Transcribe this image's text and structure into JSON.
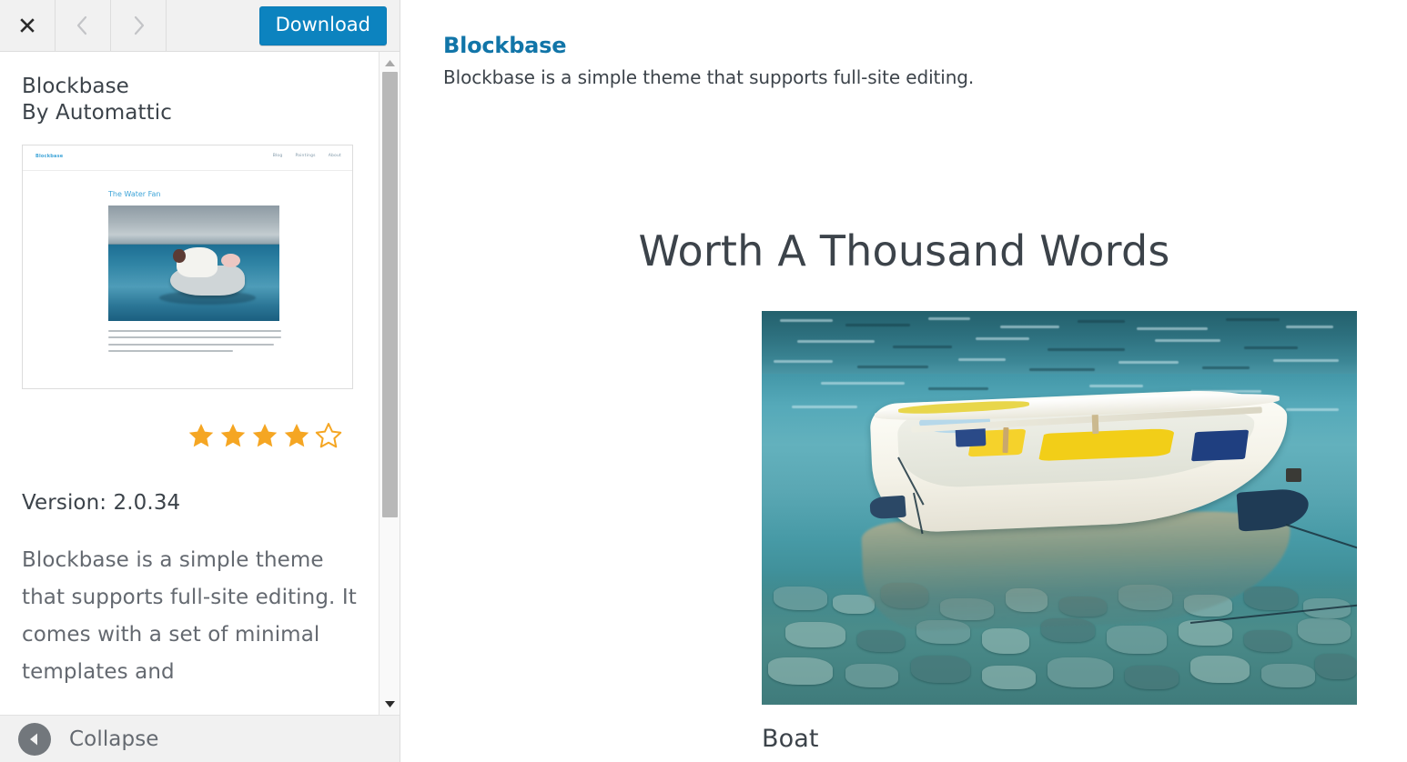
{
  "toolbar": {
    "close_icon": "close-x-icon",
    "prev_icon": "chevron-left-icon",
    "next_icon": "chevron-right-icon",
    "download_label": "Download",
    "accent_color": "#0c83bf"
  },
  "sidebar": {
    "theme_name": "Blockbase",
    "theme_author": "By Automattic",
    "rating": {
      "filled": 4,
      "total": 5,
      "star_color": "#f5a623"
    },
    "version_label": "Version: 2.0.34",
    "description": "Blockbase is a simple theme that supports full-site editing. It comes with a set of minimal templates and",
    "collapse_label": "Collapse",
    "thumbnail": {
      "logo": "Blockbase",
      "menu": [
        "Blog",
        "Paintings",
        "About"
      ],
      "post_heading": "The Water Fan",
      "body_text": "American painter Winslow Homer created The Water Fan in 1898/99. It depicts a young man searching for coral in the ocean, using a glass-bottomed bucket to see more clearly. Homer used watercolor and a heavily textured paper for this particular painting."
    },
    "scrollbar": {
      "up_arrow": "scroll-up-arrow-icon",
      "down_arrow": "scroll-down-arrow-icon"
    }
  },
  "preview": {
    "site_title": "Blockbase",
    "site_tagline": "Blockbase is a simple theme that supports full-site editing.",
    "post_title": "Worth A Thousand Words",
    "image_caption": "Boat",
    "image_alt": "Boat"
  }
}
